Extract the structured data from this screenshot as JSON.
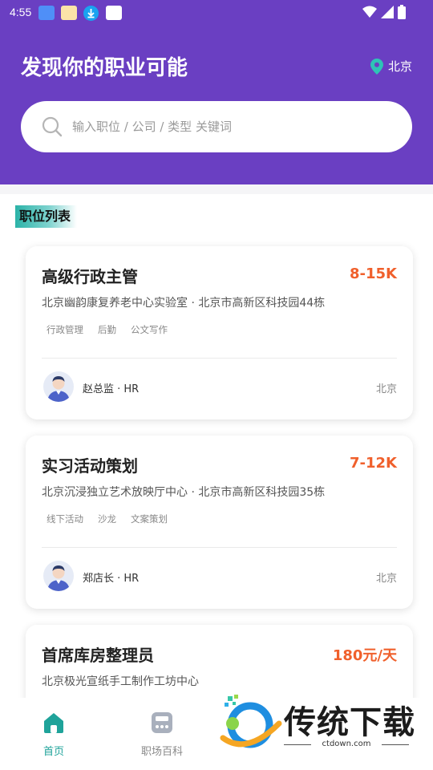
{
  "status_bar": {
    "time": "4:55",
    "notification_icons": [
      "app-icon-blue",
      "app-icon-orange",
      "download-icon",
      "app-icon-white"
    ],
    "system_icons": [
      "wifi-icon",
      "cell-signal-icon",
      "battery-icon"
    ]
  },
  "header": {
    "title": "发现你的职业可能",
    "location": "北京",
    "location_icon": "location-pin-icon"
  },
  "search": {
    "placeholder": "输入职位 / 公司 / 类型 关键词",
    "value": ""
  },
  "section": {
    "title": "职位列表"
  },
  "jobs": [
    {
      "title": "高级行政主管",
      "salary": "8-15K",
      "company": "北京幽韵康复养老中心实验室 · 北京市高新区科技园44栋",
      "tags": [
        "行政管理",
        "后勤",
        "公文写作"
      ],
      "hr": "赵总监 · HR",
      "city": "北京"
    },
    {
      "title": "实习活动策划",
      "salary": "7-12K",
      "company": "北京沉浸独立艺术放映厅中心 · 北京市高新区科技园35栋",
      "tags": [
        "线下活动",
        "沙龙",
        "文案策划"
      ],
      "hr": "郑店长 · HR",
      "city": "北京"
    },
    {
      "title": "首席库房整理员",
      "salary": "180元/天",
      "company": "北京极光宣纸手工制作工坊中心",
      "tags": [],
      "hr": "",
      "city": ""
    }
  ],
  "tabbar": {
    "items": [
      {
        "label": "首页",
        "icon": "home-icon",
        "active": true
      },
      {
        "label": "职场百科",
        "icon": "encyclopedia-icon",
        "active": false
      }
    ]
  },
  "watermark": {
    "brand": "传统下载",
    "site": "ctdown.com"
  },
  "colors": {
    "header_bg": "#6a3fc2",
    "salary": "#f0602c",
    "active_tab": "#1fa39a",
    "inactive_tab": "#888888"
  }
}
